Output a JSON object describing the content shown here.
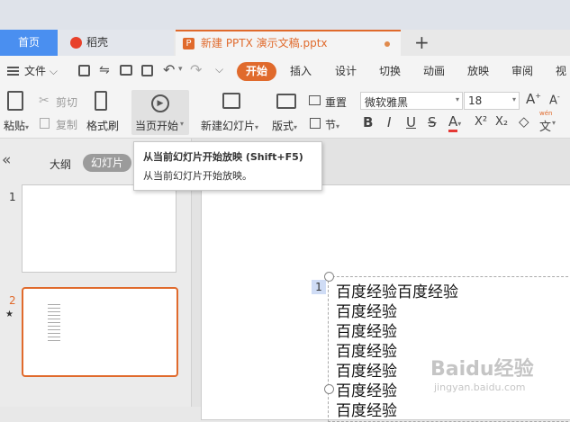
{
  "tabs": {
    "home": "首页",
    "daoke": "稻壳",
    "doc": "新建 PPTX 演示文稿.pptx",
    "new_tab": "+"
  },
  "menu": {
    "file": "文件",
    "items": [
      "开始",
      "插入",
      "设计",
      "切换",
      "动画",
      "放映",
      "审阅",
      "视图"
    ],
    "active_color": "#e06a2c"
  },
  "ribbon": {
    "paste": "粘贴",
    "cut": "剪切",
    "copy": "复制",
    "format_painter": "格式刷",
    "play_from_current": "当页开始",
    "new_slide": "新建幻灯片",
    "layout": "版式",
    "reset": "重置",
    "section": "节",
    "font_name": "微软雅黑",
    "font_size": "18",
    "bold": "B",
    "italic": "I",
    "underline": "U",
    "strike": "S",
    "font_color": "A",
    "superscript": "X²",
    "subscript": "X₂",
    "clear": "◇",
    "pinyin": "文"
  },
  "tooltip": {
    "title": "从当前幻灯片开始放映 (Shift+F5)",
    "body": "从当前幻灯片开始放映。"
  },
  "leftpanel": {
    "collapse": "«",
    "outline": "大纲",
    "slides": "幻灯片",
    "slide1_num": "1",
    "slide2_num": "2",
    "slide2_star": "★"
  },
  "slide": {
    "placeholder_num": "1",
    "lines": [
      "百度经验百度经验",
      "百度经验",
      "百度经验",
      "百度经验",
      "百度经验",
      "百度经验",
      "百度经验"
    ]
  },
  "watermark": {
    "brand": "Baidu经验",
    "url": "jingyan.baidu.com"
  }
}
